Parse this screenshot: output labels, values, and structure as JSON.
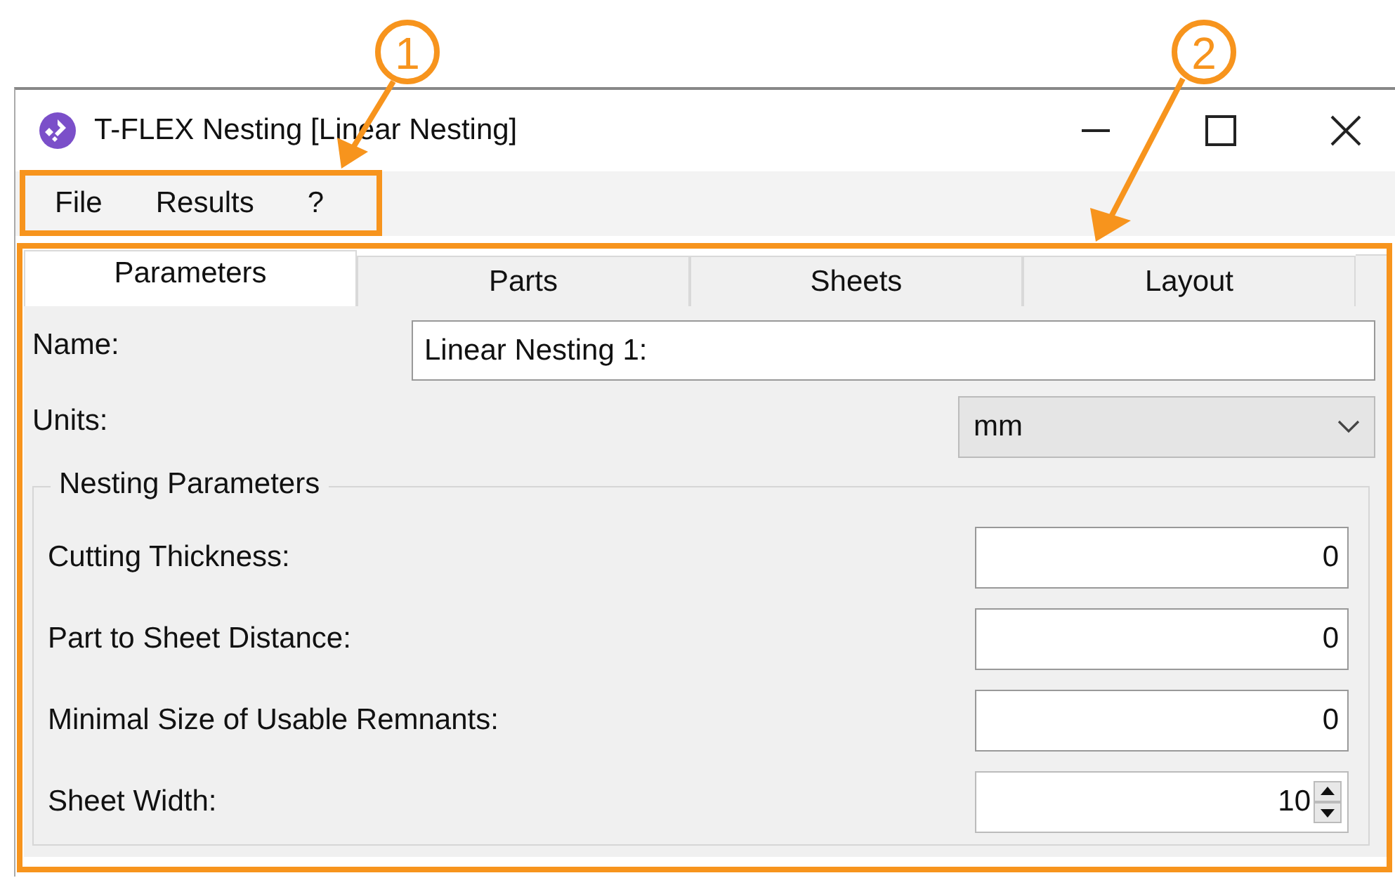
{
  "annotations": [
    {
      "label": "1"
    },
    {
      "label": "2"
    }
  ],
  "window": {
    "title": "T-FLEX Nesting [Linear Nesting]"
  },
  "menu": [
    "File",
    "Results",
    "?"
  ],
  "tabs": [
    {
      "label": "Parameters",
      "selected": true
    },
    {
      "label": "Parts",
      "selected": false
    },
    {
      "label": "Sheets",
      "selected": false
    },
    {
      "label": "Layout",
      "selected": false
    }
  ],
  "name_field": {
    "label": "Name:",
    "value": "Linear Nesting 1:"
  },
  "units": {
    "label": "Units:",
    "value": "mm"
  },
  "nesting_parameters": {
    "title": "Nesting Parameters",
    "fields": [
      {
        "label": "Cutting Thickness:",
        "value": "0",
        "kind": "text"
      },
      {
        "label": "Part to Sheet Distance:",
        "value": "0",
        "kind": "text"
      },
      {
        "label": "Minimal Size of Usable Remnants:",
        "value": "0",
        "kind": "text"
      },
      {
        "label": "Sheet Width:",
        "value": "10",
        "kind": "spin"
      }
    ]
  }
}
